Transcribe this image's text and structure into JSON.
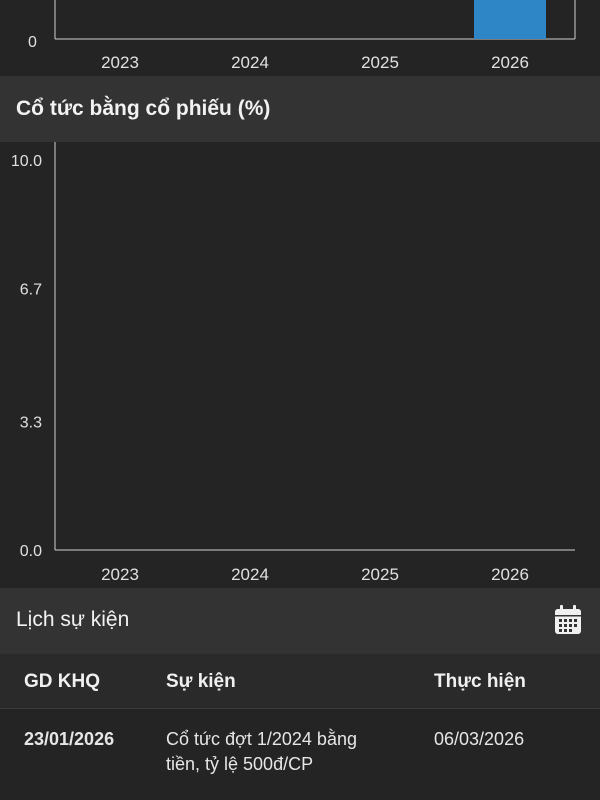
{
  "top_chart": {
    "chart_data": {
      "type": "bar",
      "categories": [
        "2023",
        "2024",
        "2025",
        "2026"
      ],
      "y_tick_visible": "0",
      "highlighted_category": "2026",
      "bar_color": "#2f86c6"
    }
  },
  "stock_dividend_section": {
    "title": "Cổ tức bằng cổ phiếu (%)"
  },
  "chart_data": {
    "type": "bar",
    "title": "Cổ tức bằng cổ phiếu (%)",
    "categories": [
      "2023",
      "2024",
      "2025",
      "2026"
    ],
    "values": [
      0,
      0,
      0,
      0
    ],
    "ylim": [
      0,
      10
    ],
    "y_ticks": [
      "0.0",
      "3.3",
      "6.7",
      "10.0"
    ],
    "grid": false
  },
  "events": {
    "title": "Lịch sự kiện",
    "calendar_icon": "calendar-icon",
    "columns": [
      "GD KHQ",
      "Sự kiện",
      "Thực hiện"
    ],
    "rows": [
      {
        "ex_date": "23/01/2026",
        "event_line1": "Cổ tức đợt 1/2024 bằng",
        "event_line2": "tiền, tỷ lệ 500đ/CP",
        "exec_date": "06/03/2026"
      }
    ]
  }
}
